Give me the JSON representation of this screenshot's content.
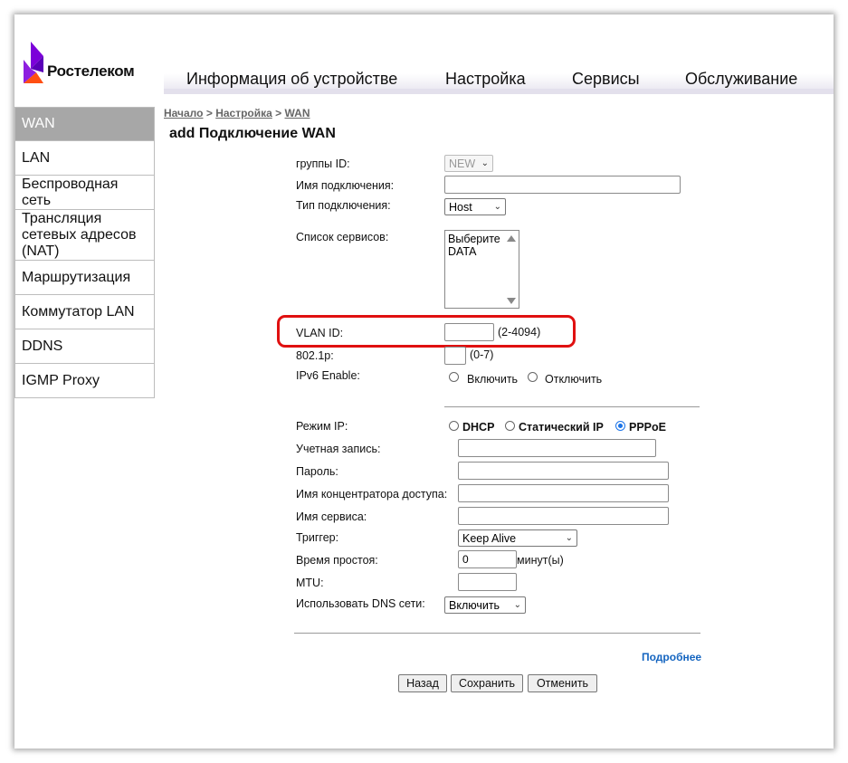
{
  "brand": {
    "name": "Ростелеком",
    "accent": "#7b00d9",
    "accent2": "#ff4f12"
  },
  "topnav": [
    "Информация об устройстве",
    "Настройка",
    "Сервисы",
    "Обслуживание"
  ],
  "sidebar": [
    "WAN",
    "LAN",
    "Беспроводная сеть",
    "Трансляция сетевых адресов (NAT)",
    "Маршрутизация",
    "Коммутатор LAN",
    "DDNS",
    "IGMP Proxy"
  ],
  "breadcrumb": {
    "home": "Начало",
    "sep": ">",
    "settings": "Настройка",
    "current": "WAN"
  },
  "page_title": "add Подключение WAN",
  "form": {
    "group_id_label": "группы ID:",
    "group_id_value": "NEW",
    "conn_name_label": "Имя подключения:",
    "conn_name_value": "",
    "conn_type_label": "Тип подключения:",
    "conn_type_value": "Host",
    "services_label": "Список сервисов:",
    "services": [
      "Выберите",
      "DATA"
    ],
    "vlan_label": "VLAN ID:",
    "vlan_value": "",
    "vlan_hint": "(2-4094)",
    "dot1p_label": "802.1p:",
    "dot1p_value": "",
    "dot1p_hint": "(0-7)",
    "ipv6_label": "IPv6 Enable:",
    "ipv6_on": "Включить",
    "ipv6_off": "Отключить",
    "ip_mode_label": "Режим IP:",
    "ip_mode_dhcp": "DHCP",
    "ip_mode_static": "Статический IP",
    "ip_mode_pppoe": "PPPoE",
    "account_label": "Учетная запись:",
    "password_label": "Пароль:",
    "ac_name_label": "Имя концентратора доступа:",
    "service_name_label": "Имя сервиса:",
    "trigger_label": "Триггер:",
    "trigger_value": "Keep Alive",
    "idle_label": "Время простоя:",
    "idle_value": "0",
    "idle_unit": "минут(ы)",
    "mtu_label": "MTU:",
    "mtu_value": "",
    "dns_label": "Использовать DNS сети:",
    "dns_value": "Включить"
  },
  "more_link": "Подробнее",
  "buttons": {
    "back": "Назад",
    "save": "Сохранить",
    "cancel": "Отменить"
  }
}
